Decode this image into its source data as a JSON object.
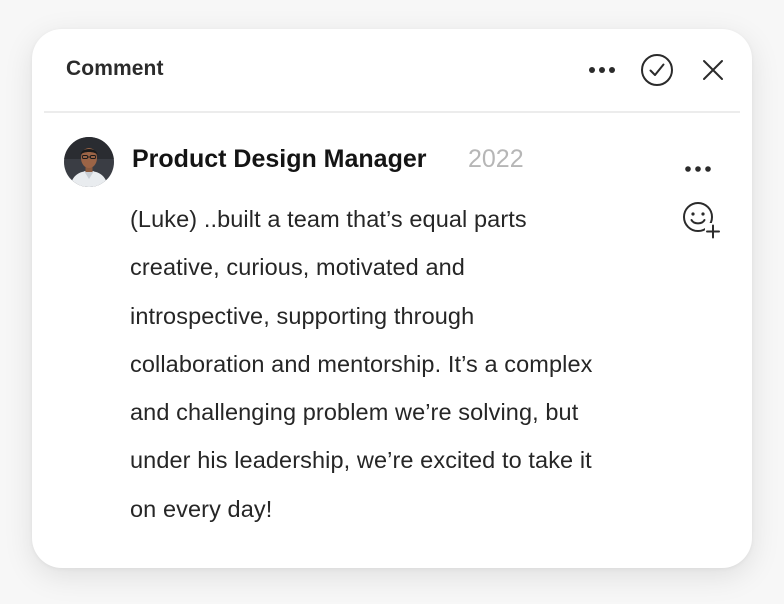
{
  "header": {
    "title": "Comment",
    "icons": {
      "more": "more-horizontal-icon",
      "resolve": "check-circle-icon",
      "close": "close-icon"
    }
  },
  "comment": {
    "author": "Product Design Manager",
    "year": "2022",
    "avatar_icon": "avatar-photo",
    "lines": [
      "(Luke) ..built a team that’s equal parts",
      "creative, curious, motivated and",
      "introspective, supporting through",
      "collaboration and mentorship. It’s a complex",
      "and challenging problem we’re solving, but",
      "under his leadership, we’re excited to take it",
      "on every day!"
    ],
    "icons": {
      "more": "more-horizontal-icon",
      "reaction": "add-reaction-icon"
    }
  },
  "colors": {
    "background": "#f7f7f7",
    "card": "#ffffff",
    "text": "#262626",
    "muted": "#b6b6b6",
    "divider": "#ececec"
  }
}
